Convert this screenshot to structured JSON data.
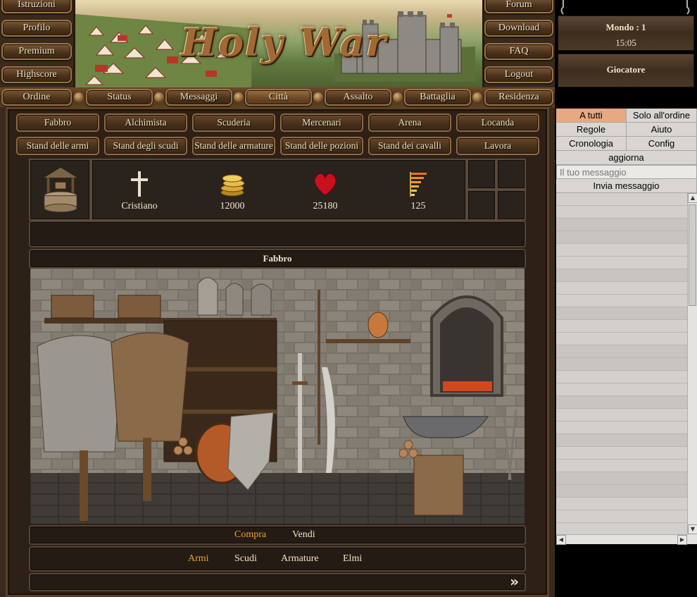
{
  "left_nav": [
    "Istruzioni",
    "Profilo",
    "Premium",
    "Highscore"
  ],
  "right_nav": [
    "Forum",
    "Download",
    "FAQ",
    "Logout"
  ],
  "banner_title": "Holy War",
  "main_tabs": [
    {
      "label": "Ordine",
      "active": false
    },
    {
      "label": "Status",
      "active": false
    },
    {
      "label": "Messaggi",
      "active": false
    },
    {
      "label": "Città",
      "active": true
    },
    {
      "label": "Assalto",
      "active": false
    },
    {
      "label": "Battaglia",
      "active": false
    },
    {
      "label": "Residenza",
      "active": false
    }
  ],
  "city_row1": [
    "Fabbro",
    "Alchimista",
    "Scuderia",
    "Mercenari",
    "Arena",
    "Locanda"
  ],
  "city_row2": [
    "Stand delle armi",
    "Stand degli scudi",
    "Stand delle armature",
    "Stand delle pozioni",
    "Stand dei cavalli",
    "Lavora"
  ],
  "stats": {
    "religion": "Cristiano",
    "gold": "12000",
    "health": "25180",
    "experience": "125"
  },
  "location_title": "Fabbro",
  "trade": {
    "buy": "Compra",
    "sell": "Vendi"
  },
  "categories": [
    "Armi",
    "Scudi",
    "Armature",
    "Elmi"
  ],
  "next_symbol": "»",
  "side": {
    "world": "Mondo : 1",
    "time": "15:05",
    "player_label": "Giocatore"
  },
  "chat": {
    "to_all": "A tutti",
    "order_only": "Solo all'ordine",
    "rules": "Regole",
    "help": "Aiuto",
    "history": "Cronologia",
    "config": "Config",
    "refresh": "aggiorna",
    "message_placeholder": "Il tuo messaggio",
    "send": "Invia messaggio"
  },
  "colors": {
    "accent_gold": "#f0a030",
    "active_chat_tab": "#e8a882"
  }
}
